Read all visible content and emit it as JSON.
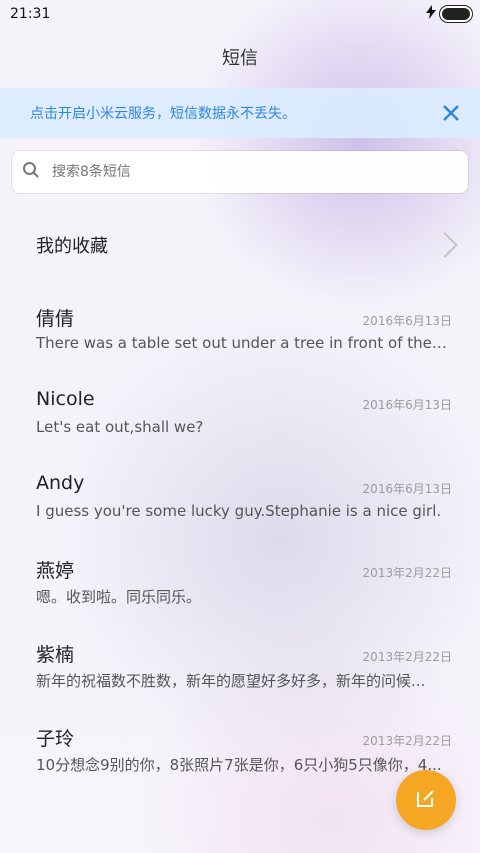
{
  "status_bar": {
    "time": "21:31"
  },
  "title": "短信",
  "banner": {
    "text": "点击开启小米云服务，短信数据永不丢失。"
  },
  "search": {
    "placeholder": "搜索8条短信"
  },
  "favorites": {
    "label": "我的收藏"
  },
  "threads": [
    {
      "name": "倩倩",
      "date": "2016年6月13日",
      "preview": "There was a table set out under a tree in front of the ho..."
    },
    {
      "name": "Nicole",
      "date": "2016年6月13日",
      "preview": "Let's eat out,shall we?"
    },
    {
      "name": "Andy",
      "date": "2016年6月13日",
      "preview": "I guess you're some lucky guy.Stephanie is a nice girl."
    },
    {
      "name": "燕婷",
      "date": "2013年2月22日",
      "preview": "嗯。收到啦。同乐同乐。"
    },
    {
      "name": "紫楠",
      "date": "2013年2月22日",
      "preview": "新年的祝福数不胜数，新年的愿望好多好多，新年的问候..."
    },
    {
      "name": "子玲",
      "date": "2013年2月22日",
      "preview": "10分想念9别的你，8张照片7张是你，6只小狗5只像你，4..."
    }
  ],
  "colors": {
    "accent": "#2f86dd",
    "fab": "#f5a623"
  },
  "icons": {
    "search": "search-icon",
    "close": "close-icon",
    "chevron": "chevron-right-icon",
    "compose": "compose-icon",
    "flash": "flash-icon",
    "battery": "battery-icon"
  }
}
